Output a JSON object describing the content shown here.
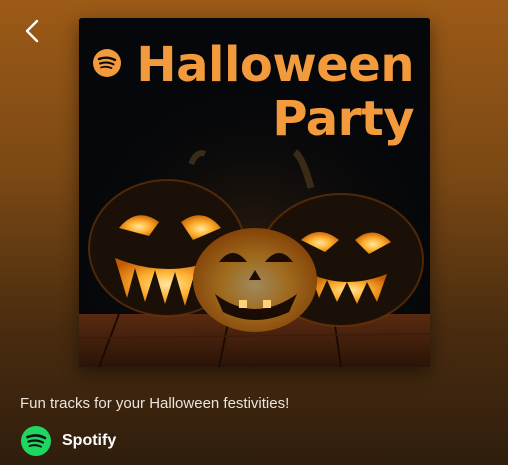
{
  "header": {
    "back_icon": "chevron-left-icon"
  },
  "playlist": {
    "cover": {
      "title_line1": "Halloween",
      "title_line2": "Party",
      "logo_icon": "spotify-logo-icon",
      "title_color": "#f39a3d"
    },
    "description": "Fun tracks for your Halloween festivities!",
    "owner": {
      "name": "Spotify",
      "avatar_icon": "spotify-logo-icon",
      "brand_color": "#1ed760"
    }
  }
}
